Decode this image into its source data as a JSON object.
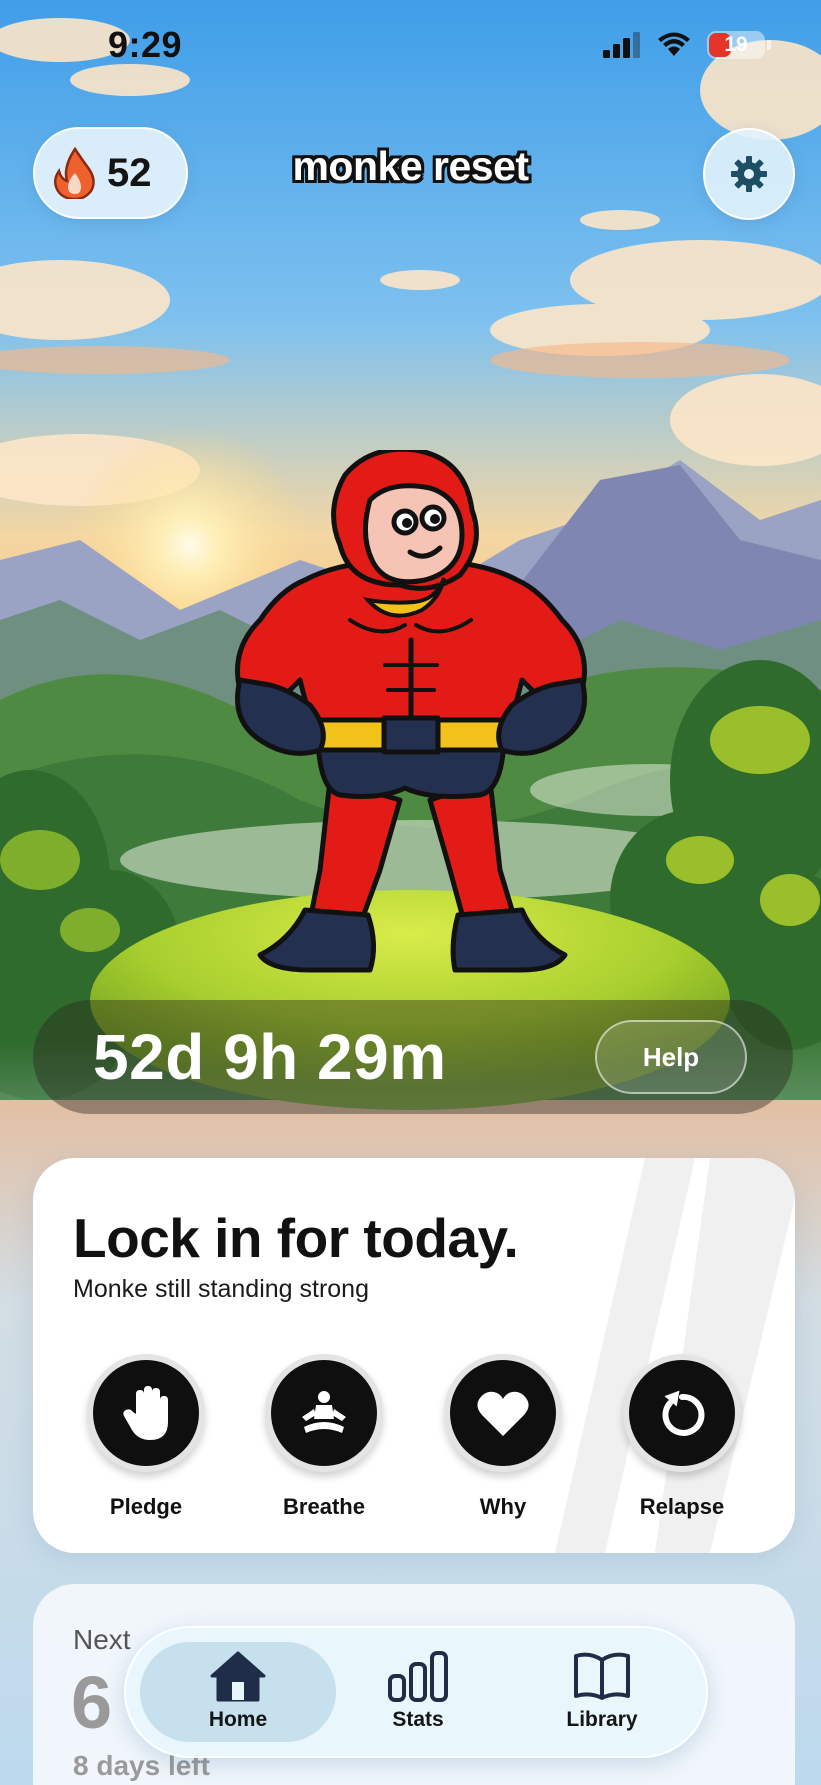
{
  "status_bar": {
    "time": "9:29",
    "battery_level": "19",
    "battery_color": "#e5352b",
    "icons": [
      "cellular-signal-icon",
      "wifi-icon",
      "battery-icon"
    ]
  },
  "header": {
    "streak_count": "52",
    "streak_icon": "flame-icon",
    "app_title": "monke reset",
    "settings_icon": "gear-icon"
  },
  "timer": {
    "elapsed": "52d 9h 29m",
    "help_label": "Help"
  },
  "lock_in_card": {
    "title": "Lock in for today.",
    "subtitle": "Monke still standing strong",
    "actions": [
      {
        "label": "Pledge",
        "icon": "hand-icon"
      },
      {
        "label": "Breathe",
        "icon": "meditation-icon"
      },
      {
        "label": "Why",
        "icon": "heart-icon"
      },
      {
        "label": "Relapse",
        "icon": "reset-icon"
      }
    ]
  },
  "next_card": {
    "label": "Next",
    "value": "6",
    "subtitle": "8 days left"
  },
  "tab_bar": {
    "tabs": [
      {
        "label": "Home",
        "icon": "home-icon",
        "active": true
      },
      {
        "label": "Stats",
        "icon": "bar-chart-icon",
        "active": false
      },
      {
        "label": "Library",
        "icon": "book-icon",
        "active": false
      }
    ]
  },
  "colors": {
    "mascot_suit": "#e31b17",
    "mascot_belt": "#f2c21b",
    "flame": "#f0602e"
  }
}
